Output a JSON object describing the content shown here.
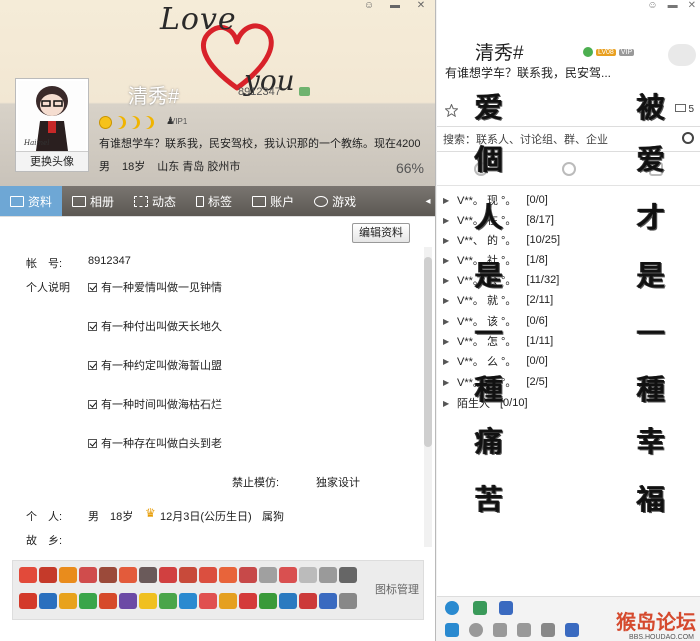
{
  "profile": {
    "window_controls": [
      "skin-icon",
      "minimize-icon",
      "close-icon"
    ],
    "banner_love": "Love",
    "banner_you": "you",
    "nickname": "清秀#",
    "qq_number_head": "8912347",
    "avatar_change_label": "更换头像",
    "avatar_caption": "Haimel",
    "vip_label": "VIP1",
    "signature": "有谁想学车？联系我，民安驾校，我认识那的一个教练。现在4200",
    "gender": "男",
    "age": "18岁",
    "location": "山东 青岛 胶州市",
    "completion": "66%",
    "tabs": [
      {
        "label": "资料",
        "active": true
      },
      {
        "label": "相册",
        "active": false
      },
      {
        "label": "动态",
        "active": false
      },
      {
        "label": "标签",
        "active": false
      },
      {
        "label": "账户",
        "active": false
      },
      {
        "label": "游戏",
        "active": false
      }
    ],
    "tab_more": "◂",
    "edit_profile_label": "编辑资料",
    "account_label": "帐　号:",
    "account_value": "8912347",
    "description_label": "个人说明",
    "description_lines": [
      "有一种爱情叫做一见钟情",
      "有一种付出叫做天长地久",
      "有一种约定叫做海誓山盟",
      "有一种时间叫做海枯石烂",
      "有一种存在叫做白头到老"
    ],
    "no_copy_label": "禁止模仿:",
    "no_copy_value": "独家设计",
    "personal_label": "个　人:",
    "personal_gender": "男",
    "personal_age": "18岁",
    "birthday": "12月3日(公历生日)",
    "zodiac": "属狗",
    "hometown_label": "故　乡:",
    "icon_manage_label": "图标管理"
  },
  "main_panel": {
    "nickname": "清秀#",
    "signature": "有谁想学车？联系我，民安驾...",
    "vip_label": "VIP",
    "level_label": "LV08",
    "search_placeholder": "搜索：联系人、讨论组、群、企业",
    "mail_count": "5",
    "groups": [
      {
        "name": "V**。 现 °。",
        "count": "[0/0]"
      },
      {
        "name": "V**。 在 °。",
        "count": "[8/17]"
      },
      {
        "name": "V**、 的 °。",
        "count": "[10/25]"
      },
      {
        "name": "V**。 社 °。",
        "count": "[1/8]"
      },
      {
        "name": "V**。 会 °。",
        "count": "[11/32]"
      },
      {
        "name": "V**。 就 °。",
        "count": "[2/11]"
      },
      {
        "name": "V**。 该 °。",
        "count": "[0/6]"
      },
      {
        "name": "V**。 怎 °。",
        "count": "[1/11]"
      },
      {
        "name": "V**。 么 °。",
        "count": "[0/0]"
      },
      {
        "name": "V**。 办 °。",
        "count": "[2/5]"
      },
      {
        "name": "陌生人",
        "count": "[0/10]"
      }
    ],
    "poem_left": [
      "爱",
      "個",
      "人",
      "是",
      "一",
      "種",
      "痛",
      "苦"
    ],
    "poem_right": [
      "被",
      "爱",
      "才",
      "是",
      "一",
      "種",
      "幸",
      "福"
    ],
    "watermark": "猴岛论坛",
    "watermark_sub": "BBS.HOUDAO.COM"
  }
}
